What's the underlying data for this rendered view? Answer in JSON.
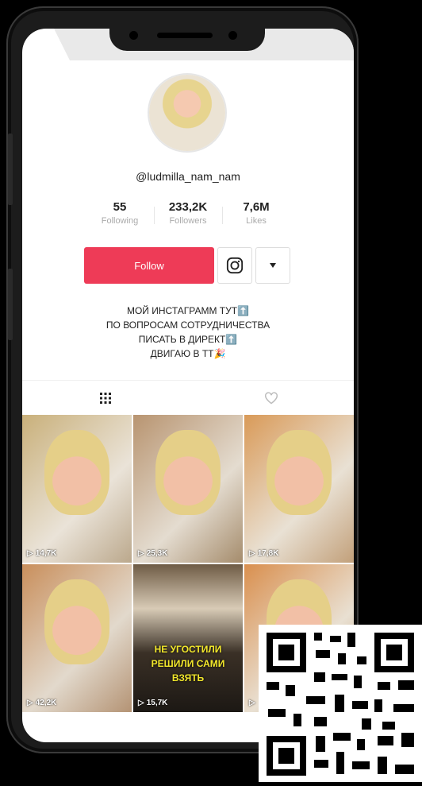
{
  "profile": {
    "username": "@ludmilla_nam_nam",
    "stats": [
      {
        "value": "55",
        "label": "Following"
      },
      {
        "value": "233,2K",
        "label": "Followers"
      },
      {
        "value": "7,6M",
        "label": "Likes"
      }
    ],
    "follow_label": "Follow",
    "bio": [
      "МОЙ ИНСТАГРАММ ТУТ⬆️",
      "ПО ВОПРОСАМ СОТРУДНИЧЕСТВА",
      "ПИСАТЬ В ДИРЕКТ⬆️",
      "ДВИГАЮ В ТТ🎉"
    ]
  },
  "icons": {
    "instagram": "instagram-icon",
    "dropdown": "caret-down-icon",
    "videos_tab": "grid-icon",
    "liked_tab": "heart-icon"
  },
  "colors": {
    "follow": "#ee3b57"
  },
  "videos": [
    {
      "views": "14,7K"
    },
    {
      "views": "25,3K"
    },
    {
      "views": "17,8K"
    },
    {
      "views": "42,2K"
    },
    {
      "views": "15,7K",
      "caption": [
        "НЕ УГОСТИЛИ",
        "РЕШИЛИ САМИ",
        "ВЗЯТЬ"
      ]
    },
    {
      "views": ""
    }
  ]
}
